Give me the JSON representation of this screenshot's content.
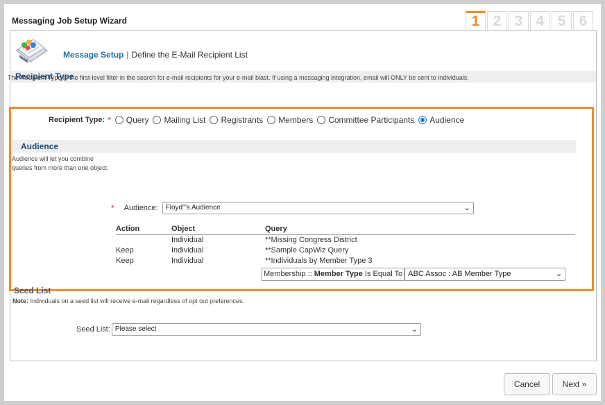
{
  "wizard": {
    "title": "Messaging Job Setup Wizard",
    "steps": [
      "1",
      "2",
      "3",
      "4",
      "5",
      "6"
    ]
  },
  "header": {
    "link": "Message Setup",
    "separator": "|",
    "subtitle": "Define the E-Mail Recipient List"
  },
  "recipient_type": {
    "section_title": "Recipient Type",
    "description": "The Recipient Type is the first-level filter in the search for e-mail recipients for your e-mail blast. If using a messaging integration, email will ONLY be sent to individuals.",
    "label": "Recipient Type:",
    "required_marker": "*",
    "options": [
      "Query",
      "Mailing List",
      "Registrants",
      "Members",
      "Committee Participants",
      "Audience"
    ],
    "selected": "Audience"
  },
  "audience": {
    "section_title": "Audience",
    "description": "Audience will let you combine queries from more than one object.",
    "label": "Audience:",
    "required_marker": "*",
    "selected_value": "Floyd'''s Audience"
  },
  "audience_table": {
    "headers": [
      "Action",
      "Object",
      "Query"
    ],
    "rows": [
      {
        "action": "",
        "object": "Individual",
        "query": "**Missing Congress District"
      },
      {
        "action": "Keep",
        "object": "Individual",
        "query": "**Sample CapWiz Query"
      },
      {
        "action": "Keep",
        "object": "Individual",
        "query": "**Individuals by Member Type 3"
      }
    ],
    "filter": {
      "prefix": "Membership ::",
      "field": "Member Type",
      "operator": "Is Equal To",
      "value": "ABC Assoc : AB Member Type"
    }
  },
  "seed_list": {
    "section_title": "Seed List",
    "note_label": "Note:",
    "note": "Individuals on a seed list will receive e-mail regardless of opt out preferences.",
    "label": "Seed List:",
    "selected_value": "Please select"
  },
  "buttons": {
    "cancel": "Cancel",
    "next": "Next »"
  },
  "colors": {
    "highlight": "#f28c28",
    "link": "#1f6fa8",
    "section_text": "#1f4e79",
    "radio_selected": "#1a73e8"
  }
}
